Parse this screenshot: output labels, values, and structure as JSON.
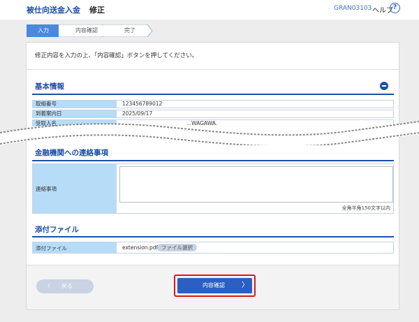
{
  "header": {
    "app_title": "被仕向送金入金",
    "page_title": "修正",
    "screen_id": "GRAN03103",
    "help_label": "ヘルプ",
    "help_icon": "?"
  },
  "steps": [
    {
      "label": "入力",
      "active": true
    },
    {
      "label": "内容確認",
      "active": false
    },
    {
      "label": "完了",
      "active": false
    }
  ],
  "instruction": "修正内容を入力の上、「内容確認」ボタンを押してください。",
  "basic_info": {
    "title": "基本情報",
    "rows": [
      {
        "label": "取組番号",
        "value": "123456789012"
      },
      {
        "label": "到着案内日",
        "value": "2025/09/17"
      },
      {
        "label": "受取人名",
        "value": "...WAGAWA."
      }
    ]
  },
  "contact": {
    "title": "金融機関への連絡事項",
    "field_label": "連絡事項",
    "value": "",
    "char_limit": "全角半角150文字以内"
  },
  "attachment": {
    "title": "添付ファイル",
    "field_label": "添付ファイル",
    "file_name": "extension.pdf",
    "select_button": "ファイル選択"
  },
  "footer": {
    "back_label": "戻る",
    "back_chevron": "〈",
    "confirm_label": "内容確認",
    "confirm_chevron": "〉"
  },
  "colors": {
    "accent": "#1d4fa8",
    "label_bg": "#b7dcf7",
    "highlight": "#e0141c"
  }
}
